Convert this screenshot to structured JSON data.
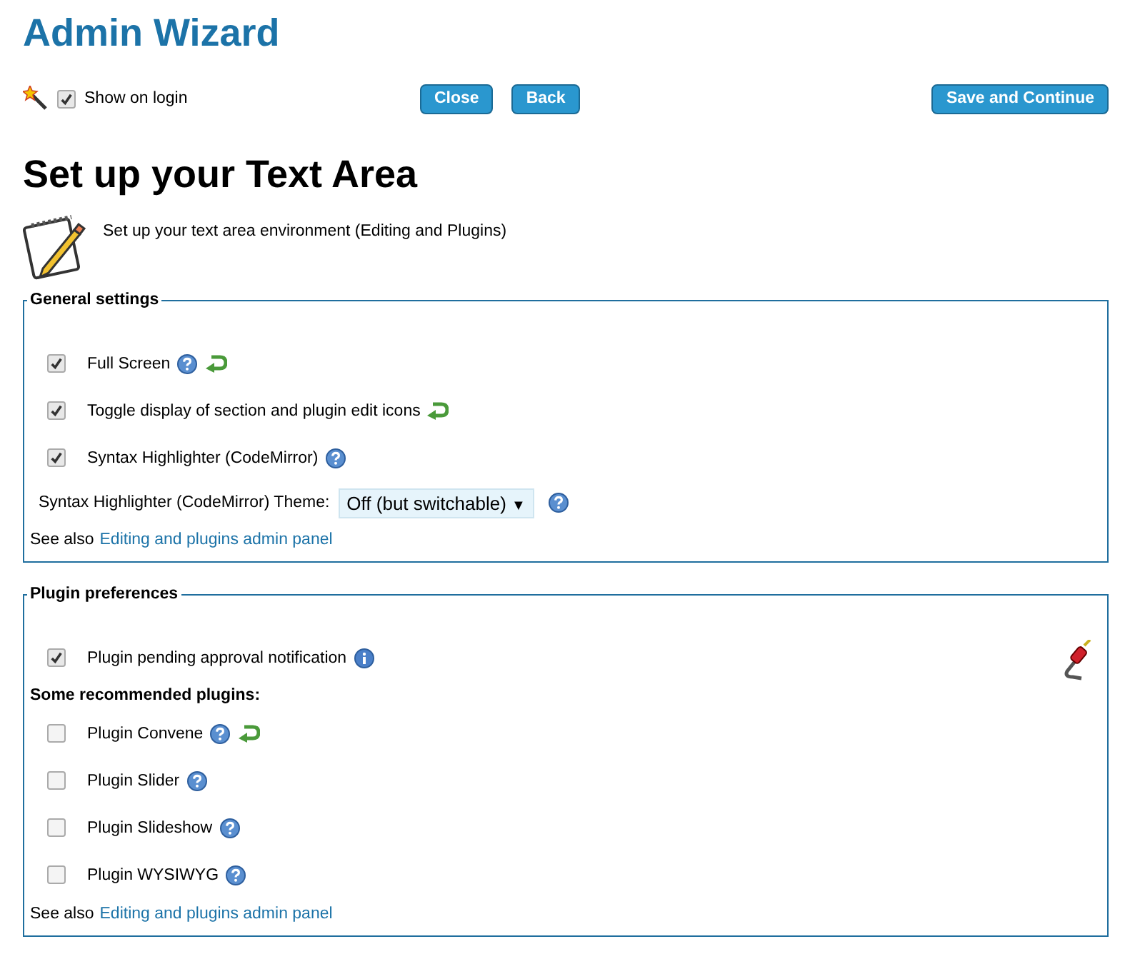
{
  "title": "Admin Wizard",
  "top_bar": {
    "show_on_login": {
      "label": "Show on login",
      "checked": true
    },
    "buttons": [
      {
        "label": "Close",
        "kind": "left"
      },
      {
        "label": "Back",
        "kind": "left"
      },
      {
        "label": "Save and Continue",
        "kind": "right"
      }
    ]
  },
  "heading": "Set up your Text Area",
  "intro": "Set up your text area environment (Editing and Plugins)",
  "sections": [
    {
      "legend": "General settings",
      "rows": [
        {
          "kind": "checkbox",
          "label": "Full Screen",
          "checked": true,
          "help": true,
          "reset": true
        },
        {
          "kind": "checkbox",
          "label": "Toggle display of section and plugin edit icons",
          "checked": true,
          "reset": true
        },
        {
          "kind": "checkbox",
          "label": "Syntax Highlighter (CodeMirror)",
          "checked": true,
          "help": true
        },
        {
          "kind": "select",
          "label": "Syntax Highlighter (CodeMirror) Theme:",
          "value": "Off (but switchable)",
          "arrow": "▼",
          "help": true
        }
      ],
      "see_also": {
        "text": "See also",
        "link": "Editing and plugins admin panel"
      }
    },
    {
      "legend": "Plugin preferences",
      "plug_icon": true,
      "rows": [
        {
          "kind": "checkbox",
          "label": "Plugin pending approval notification",
          "checked": true,
          "info": true
        },
        {
          "kind": "subheading",
          "label": "Some recommended plugins:"
        },
        {
          "kind": "checkbox",
          "label": "Plugin Convene",
          "checked": false,
          "help": true,
          "reset": true
        },
        {
          "kind": "checkbox",
          "label": "Plugin Slider",
          "checked": false,
          "help": true
        },
        {
          "kind": "checkbox",
          "label": "Plugin Slideshow",
          "checked": false,
          "help": true
        },
        {
          "kind": "checkbox",
          "label": "Plugin WYSIWYG",
          "checked": false,
          "help": true
        }
      ],
      "see_also": {
        "text": "See also",
        "link": "Editing and plugins admin panel"
      }
    }
  ]
}
